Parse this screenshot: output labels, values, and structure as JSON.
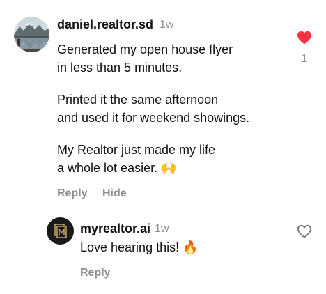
{
  "comment": {
    "username": "daniel.realtor.sd",
    "time": "1w",
    "lines": [
      "Generated my open house flyer",
      "in less than 5 minutes.",
      "Printed it the same afternoon",
      "and used it for weekend showings.",
      "My Realtor just made my life",
      "a whole lot easier. 🙌"
    ],
    "reply_label": "Reply",
    "hide_label": "Hide",
    "like_count": "1",
    "liked": true,
    "avatar_icon": "mountain-lake-photo"
  },
  "reply": {
    "username": "myrealtor.ai",
    "time": "1w",
    "text": "Love hearing this! 🔥",
    "reply_label": "Reply",
    "liked": false,
    "avatar_icon": "myrealtor-logo"
  },
  "colors": {
    "heart_active": "#ff3040",
    "muted": "#8e8e8e",
    "logo_bg": "#1a1a1a",
    "logo_gold": "#c9a85c"
  }
}
